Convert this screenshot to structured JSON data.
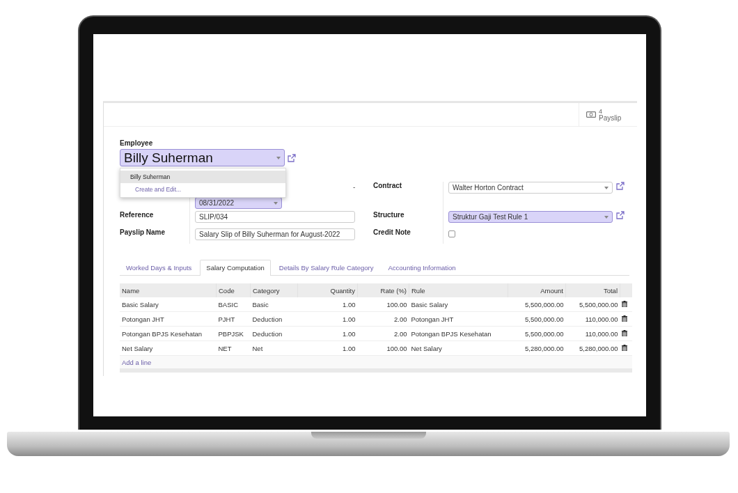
{
  "stat_button": {
    "count": "4",
    "label": "Payslip"
  },
  "employee": {
    "label": "Employee",
    "value": "Billy Suherman",
    "required": true,
    "dropdown": [
      {
        "label": "Billy Suherman",
        "kind": "option",
        "selected": true
      },
      {
        "label": "Create and Edit...",
        "kind": "action",
        "selected": false
      }
    ]
  },
  "period": {
    "separator": "-",
    "date_to": {
      "value": "08/31/2022",
      "required": true
    }
  },
  "fields_left": [
    {
      "label": "Reference",
      "value": "SLIP/034",
      "required": false
    },
    {
      "label": "Payslip Name",
      "value": "Salary Slip of Billy Suherman for August-2022",
      "required": false
    }
  ],
  "contract": {
    "label": "Contract",
    "value": "Walter Horton Contract",
    "required": false
  },
  "structure": {
    "label": "Structure",
    "value": "Struktur Gaji Test Rule 1",
    "required": true
  },
  "credit_note": {
    "label": "Credit Note",
    "checked": false
  },
  "tabs": [
    {
      "label": "Worked Days & Inputs",
      "selected": false
    },
    {
      "label": "Salary Computation",
      "selected": true
    },
    {
      "label": "Details By Salary Rule Category",
      "selected": false
    },
    {
      "label": "Accounting Information",
      "selected": false
    }
  ],
  "table": {
    "columns": [
      {
        "label": "Name",
        "kind": "text"
      },
      {
        "label": "Code",
        "kind": "text"
      },
      {
        "label": "Category",
        "kind": "text"
      },
      {
        "label": "Quantity",
        "kind": "number"
      },
      {
        "label": "Rate (%)",
        "kind": "number"
      },
      {
        "label": "Rule",
        "kind": "text"
      },
      {
        "label": "Amount",
        "kind": "number"
      },
      {
        "label": "Total",
        "kind": "number"
      }
    ],
    "rows": [
      [
        "Basic Salary",
        "BASIC",
        "Basic",
        "1.00",
        "100.00",
        "Basic Salary",
        "5,500,000.00",
        "5,500,000.00"
      ],
      [
        "Potongan JHT",
        "PJHT",
        "Deduction",
        "1.00",
        "2.00",
        "Potongan JHT",
        "5,500,000.00",
        "110,000.00"
      ],
      [
        "Potongan BPJS Kesehatan",
        "PBPJSK",
        "Deduction",
        "1.00",
        "2.00",
        "Potongan BPJS Kesehatan",
        "5,500,000.00",
        "110,000.00"
      ],
      [
        "Net Salary",
        "NET",
        "Net",
        "1.00",
        "100.00",
        "Net Salary",
        "5,280,000.00",
        "5,280,000.00"
      ]
    ],
    "add_line": "Add a line"
  }
}
